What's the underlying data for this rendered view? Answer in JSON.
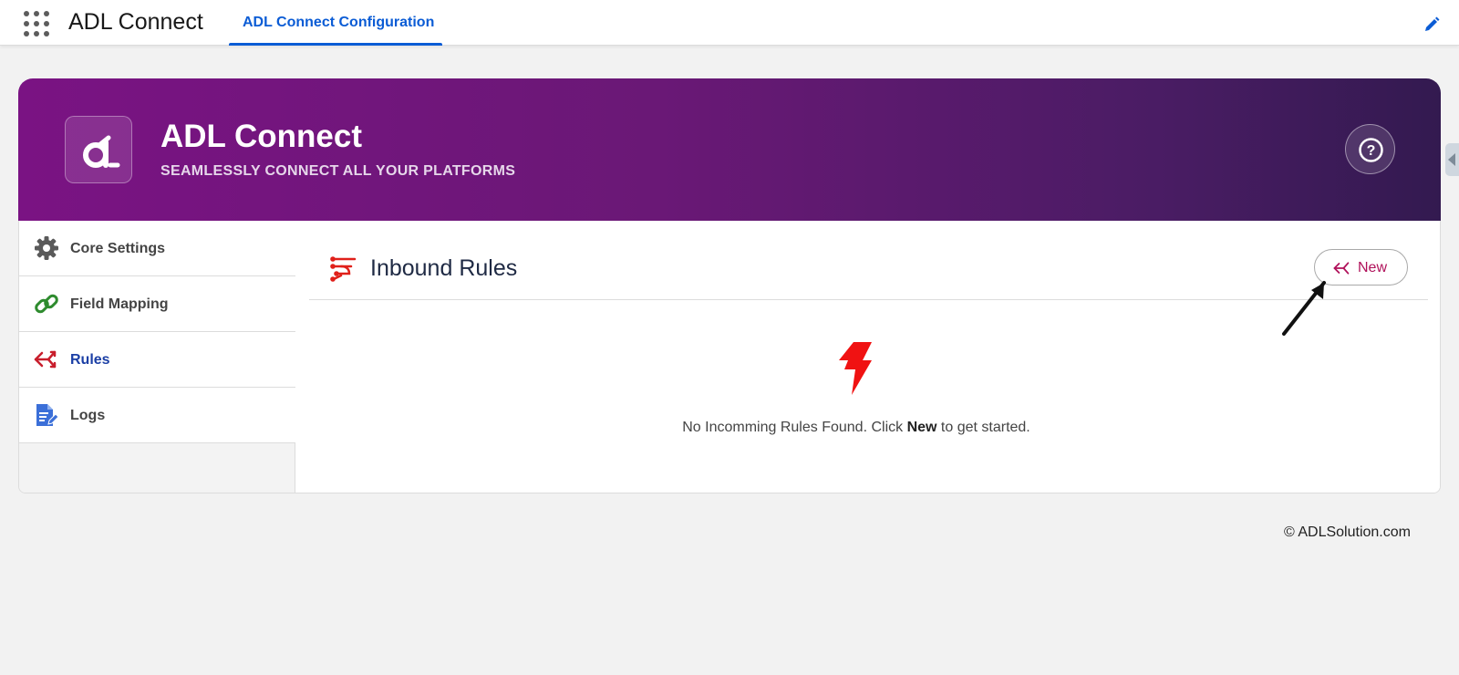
{
  "app": {
    "name": "ADL Connect"
  },
  "nav": {
    "tab_label": "ADL Connect Configuration"
  },
  "banner": {
    "title": "ADL Connect",
    "subtitle": "SEAMLESSLY CONNECT ALL YOUR PLATFORMS",
    "logo_text": "d",
    "help_label": "?"
  },
  "sidebar": {
    "items": [
      {
        "label": "Core Settings",
        "icon": "gear-icon",
        "active": false
      },
      {
        "label": "Field Mapping",
        "icon": "link-icon",
        "active": false
      },
      {
        "label": "Rules",
        "icon": "rules-icon",
        "active": true
      },
      {
        "label": "Logs",
        "icon": "document-icon",
        "active": false
      }
    ]
  },
  "panel": {
    "title": "Inbound Rules",
    "new_button": "New",
    "empty": {
      "prefix": "No Incomming Rules Found. Click ",
      "bold": "New",
      "suffix": " to get started."
    }
  },
  "colors": {
    "accent": "#0b5cd5",
    "banner_start": "#7a1383",
    "banner_end": "#331a50",
    "rule_red": "#e0201a",
    "new_text": "#b0115a"
  },
  "footer": {
    "text": "© ADLSolution.com"
  }
}
